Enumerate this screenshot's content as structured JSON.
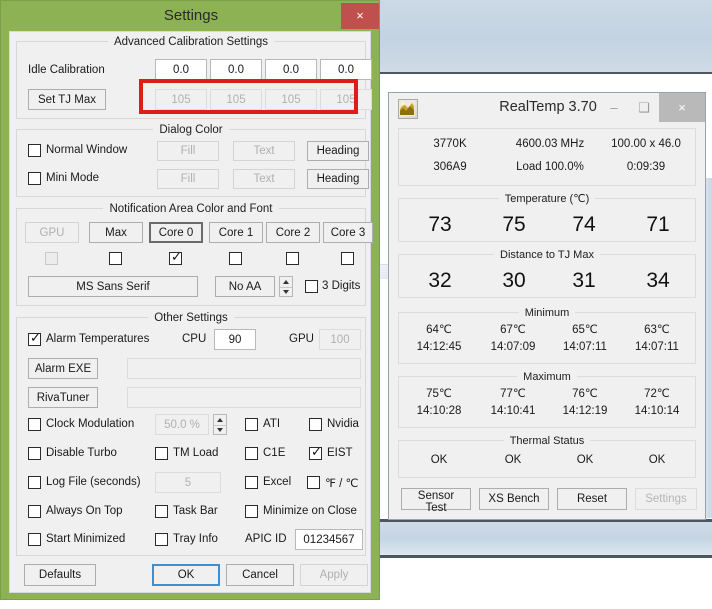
{
  "colors": {
    "window_chrome_green": "#8cb254",
    "close_red": "#c0504d",
    "annotation_red": "#e01b1b",
    "focus_blue": "#3c8fd0",
    "panel_gray": "#f0f0f0"
  },
  "settings_window": {
    "title": "Settings",
    "close_label": "×",
    "advanced_calibration": {
      "title": "Advanced Calibration Settings",
      "idle_calibration_label": "Idle Calibration",
      "idle_calibration_values": [
        "0.0",
        "0.0",
        "0.0",
        "0.0"
      ],
      "set_tj_max_label": "Set TJ Max",
      "tj_max_values": [
        "105",
        "105",
        "105",
        "105"
      ]
    },
    "dialog_color": {
      "title": "Dialog Color",
      "rows": [
        {
          "checkbox_label": "Normal Window",
          "checked": false,
          "fill_label": "Fill",
          "text_label": "Text",
          "heading_label": "Heading"
        },
        {
          "checkbox_label": "Mini Mode",
          "checked": false,
          "fill_label": "Fill",
          "text_label": "Text",
          "heading_label": "Heading"
        }
      ]
    },
    "notification_area": {
      "title": "Notification Area Color and Font",
      "source_buttons": [
        {
          "label": "GPU",
          "disabled": true,
          "focused": false,
          "checked": false,
          "checkbox_disabled": true
        },
        {
          "label": "Max",
          "disabled": false,
          "focused": false,
          "checked": false,
          "checkbox_disabled": false
        },
        {
          "label": "Core 0",
          "disabled": false,
          "focused": true,
          "checked": true,
          "checkbox_disabled": false
        },
        {
          "label": "Core 1",
          "disabled": false,
          "focused": false,
          "checked": false,
          "checkbox_disabled": false
        },
        {
          "label": "Core 2",
          "disabled": false,
          "focused": false,
          "checked": false,
          "checkbox_disabled": false
        },
        {
          "label": "Core 3",
          "disabled": false,
          "focused": false,
          "checked": false,
          "checkbox_disabled": false
        }
      ],
      "font_button_label": "MS Sans Serif",
      "aa_button_label": "No AA",
      "three_digits_label": "3 Digits",
      "three_digits_checked": false
    },
    "other_settings": {
      "title": "Other Settings",
      "alarm_temperatures_label": "Alarm Temperatures",
      "alarm_temperatures_checked": true,
      "cpu_label": "CPU",
      "cpu_value": "90",
      "gpu_label": "GPU",
      "gpu_value": "100",
      "gpu_disabled": true,
      "alarm_exe_label": "Alarm EXE",
      "alarm_exe_value": "",
      "rivatuner_label": "RivaTuner",
      "rivatuner_value": "",
      "clock_modulation_label": "Clock Modulation",
      "clock_modulation_checked": false,
      "clock_modulation_value": "50.0 %",
      "ati_label": "ATI",
      "ati_checked": false,
      "nvidia_label": "Nvidia",
      "nvidia_checked": false,
      "disable_turbo_label": "Disable Turbo",
      "disable_turbo_checked": false,
      "tm_load_label": "TM Load",
      "tm_load_checked": false,
      "c1e_label": "C1E",
      "c1e_checked": false,
      "eist_label": "EIST",
      "eist_checked": true,
      "log_file_label": "Log File (seconds)",
      "log_file_checked": false,
      "log_file_value": "5",
      "excel_label": "Excel",
      "excel_checked": false,
      "units_label": "℉ / ℃",
      "units_checked": false,
      "always_on_top_label": "Always On Top",
      "always_on_top_checked": false,
      "task_bar_label": "Task Bar",
      "task_bar_checked": false,
      "minimize_on_close_label": "Minimize on Close",
      "minimize_on_close_checked": false,
      "start_minimized_label": "Start Minimized",
      "start_minimized_checked": false,
      "tray_info_label": "Tray Info",
      "tray_info_checked": false,
      "apic_id_label": "APIC ID",
      "apic_id_value": "01234567"
    },
    "footer": {
      "defaults_label": "Defaults",
      "ok_label": "OK",
      "ok_focused": true,
      "cancel_label": "Cancel",
      "apply_label": "Apply",
      "apply_disabled": true
    }
  },
  "realtemp_window": {
    "title": "RealTemp 3.70",
    "minimize_label": "–",
    "maximize_label": "❑",
    "close_label": "×",
    "info": {
      "cpu_model": "3770K",
      "frequency": "4600.03 MHz",
      "multiplier": "100.00 x 46.0",
      "cpu_id": "306A9",
      "load": "Load 100.0%",
      "uptime": "0:09:39"
    },
    "temperature": {
      "title": "Temperature (℃)",
      "values": [
        "73",
        "75",
        "74",
        "71"
      ]
    },
    "distance_to_tj_max": {
      "title": "Distance to TJ Max",
      "values": [
        "32",
        "30",
        "31",
        "34"
      ]
    },
    "minimum": {
      "title": "Minimum",
      "values": [
        "64℃",
        "67℃",
        "65℃",
        "63℃"
      ],
      "times": [
        "14:12:45",
        "14:07:09",
        "14:07:11",
        "14:07:11"
      ]
    },
    "maximum": {
      "title": "Maximum",
      "values": [
        "75℃",
        "77℃",
        "76℃",
        "72℃"
      ],
      "times": [
        "14:10:28",
        "14:10:41",
        "14:12:19",
        "14:10:14"
      ]
    },
    "thermal_status": {
      "title": "Thermal Status",
      "values": [
        "OK",
        "OK",
        "OK",
        "OK"
      ]
    },
    "buttons": [
      {
        "label": "Sensor Test",
        "disabled": false
      },
      {
        "label": "XS Bench",
        "disabled": false
      },
      {
        "label": "Reset",
        "disabled": false
      },
      {
        "label": "Settings",
        "disabled": true
      }
    ]
  }
}
